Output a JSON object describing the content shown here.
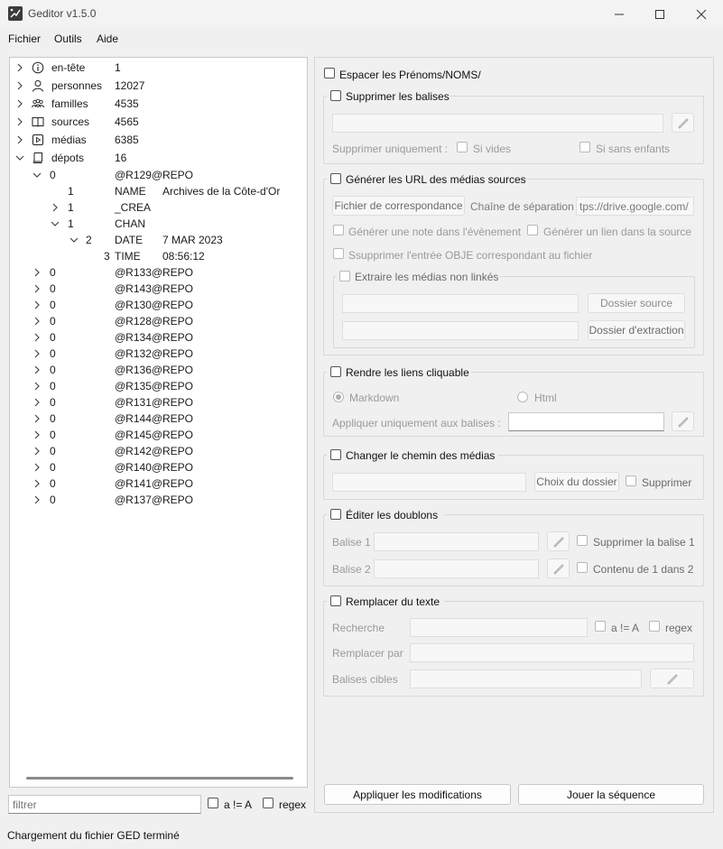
{
  "window": {
    "title": "Geditor v1.5.0"
  },
  "menu": {
    "file": "Fichier",
    "tools": "Outils",
    "help": "Aide"
  },
  "tree": {
    "root": [
      {
        "label": "en-tête",
        "count": "1",
        "icon": "info-icon"
      },
      {
        "label": "personnes",
        "count": "12027",
        "icon": "person-icon"
      },
      {
        "label": "familles",
        "count": "4535",
        "icon": "family-icon"
      },
      {
        "label": "sources",
        "count": "4565",
        "icon": "book-icon"
      },
      {
        "label": "médias",
        "count": "6385",
        "icon": "media-icon"
      },
      {
        "label": "dépots",
        "count": "16",
        "icon": "repository-icon"
      }
    ],
    "expanded": [
      {
        "level": "0",
        "tag": "@R129@",
        "value": "REPO"
      },
      {
        "level": "1",
        "tag": "NAME",
        "value": "Archives de la Côte-d'Or"
      },
      {
        "level": "1",
        "tag": "_CREA",
        "value": ""
      },
      {
        "level": "1",
        "tag": "CHAN",
        "value": ""
      },
      {
        "level": "2",
        "tag": "DATE",
        "value": "7 MAR 2023"
      },
      {
        "level": "3",
        "tag": "TIME",
        "value": "08:56:12"
      }
    ],
    "repos": [
      {
        "level": "0",
        "tag": "@R133@",
        "value": "REPO"
      },
      {
        "level": "0",
        "tag": "@R143@",
        "value": "REPO"
      },
      {
        "level": "0",
        "tag": "@R130@",
        "value": "REPO"
      },
      {
        "level": "0",
        "tag": "@R128@",
        "value": "REPO"
      },
      {
        "level": "0",
        "tag": "@R134@",
        "value": "REPO"
      },
      {
        "level": "0",
        "tag": "@R132@",
        "value": "REPO"
      },
      {
        "level": "0",
        "tag": "@R136@",
        "value": "REPO"
      },
      {
        "level": "0",
        "tag": "@R135@",
        "value": "REPO"
      },
      {
        "level": "0",
        "tag": "@R131@",
        "value": "REPO"
      },
      {
        "level": "0",
        "tag": "@R144@",
        "value": "REPO"
      },
      {
        "level": "0",
        "tag": "@R145@",
        "value": "REPO"
      },
      {
        "level": "0",
        "tag": "@R142@",
        "value": "REPO"
      },
      {
        "level": "0",
        "tag": "@R140@",
        "value": "REPO"
      },
      {
        "level": "0",
        "tag": "@R141@",
        "value": "REPO"
      },
      {
        "level": "0",
        "tag": "@R137@",
        "value": "REPO"
      }
    ]
  },
  "filter": {
    "placeholder": "filtrer",
    "case_label": "a != A",
    "regex_label": "regex"
  },
  "status": {
    "text": "Chargement du fichier GED terminé"
  },
  "options": {
    "space_names": "Espacer les Prénoms/NOMS/",
    "remove_tags": {
      "title": "Supprimer les balises",
      "only_label": "Supprimer uniquement :",
      "if_empty": "Si vides",
      "if_no_children": "Si sans enfants"
    },
    "media_urls": {
      "title": "Générer les URL des médias sources",
      "mapping_button": "Fichier de correspondance",
      "separator_label": "Chaîne de séparation",
      "separator_value": "tps://drive.google.com/",
      "note_in_event": "Générer une note dans l'évènement",
      "link_in_source": "Générer un lien dans la source",
      "remove_obje": "Ssupprimer l'entrée OBJE correspondant au fichier",
      "extract_unlinked": "Extraire les médias non linkés",
      "source_folder_button": "Dossier source",
      "extract_folder_button": "Dossier d'extraction"
    },
    "clickable_links": {
      "title": "Rendre les liens cliquable",
      "markdown": "Markdown",
      "html": "Html",
      "apply_only_label": "Appliquer uniquement aux balises :"
    },
    "media_path": {
      "title": "Changer le chemin des médias",
      "choose_folder_button": "Choix du dossier",
      "delete_label": "Supprimer"
    },
    "duplicates": {
      "title": "Éditer les doublons",
      "tag1_label": "Balise 1",
      "tag2_label": "Balise 2",
      "remove_tag1": "Supprimer la balise 1",
      "content_1_in_2": "Contenu de 1 dans 2"
    },
    "replace_text": {
      "title": "Remplacer du texte",
      "search_label": "Recherche",
      "case_label": "a != A",
      "regex_label": "regex",
      "replace_with_label": "Remplacer par",
      "target_tags_label": "Balises cibles"
    }
  },
  "actions": {
    "apply": "Appliquer les modifications",
    "play_sequence": "Jouer la séquence"
  }
}
